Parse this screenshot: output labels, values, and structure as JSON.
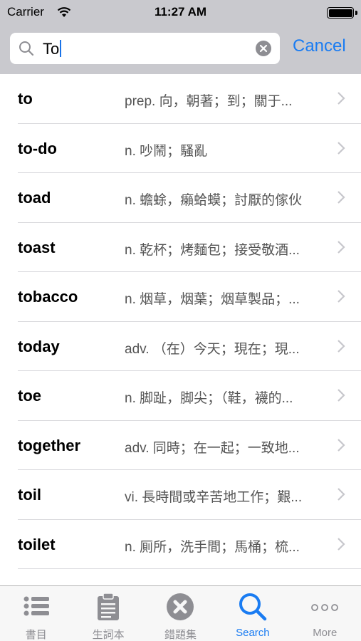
{
  "status_bar": {
    "carrier": "Carrier",
    "time": "11:27 AM"
  },
  "search": {
    "value": "To",
    "cancel_label": "Cancel"
  },
  "results": [
    {
      "word": "to",
      "definition": "prep. 向，朝著；到；關于..."
    },
    {
      "word": "to-do",
      "definition": "n. 吵鬧；騷亂"
    },
    {
      "word": "toad",
      "definition": "n. 蟾蜍，癩蛤蟆；討厭的傢伙"
    },
    {
      "word": "toast",
      "definition": "n. 乾杯；烤麵包；接受敬酒..."
    },
    {
      "word": "tobacco",
      "definition": "n. 烟草，烟葉；烟草製品；..."
    },
    {
      "word": "today",
      "definition": "adv. （在）今天；現在；現..."
    },
    {
      "word": "toe",
      "definition": "n. 脚趾，脚尖；（鞋，襪的..."
    },
    {
      "word": "together",
      "definition": "adv. 同時；在一起；一致地..."
    },
    {
      "word": "toil",
      "definition": "vi. 長時間或辛苦地工作；艱..."
    },
    {
      "word": "toilet",
      "definition": "n. 厠所，洗手間；馬桶；梳..."
    }
  ],
  "tabs": [
    {
      "label": "書目",
      "icon": "list-icon"
    },
    {
      "label": "生詞本",
      "icon": "clipboard-icon"
    },
    {
      "label": "錯題集",
      "icon": "x-circle-icon"
    },
    {
      "label": "Search",
      "icon": "search-icon"
    },
    {
      "label": "More",
      "icon": "more-icon"
    }
  ],
  "colors": {
    "accent": "#1a7cf2",
    "header_bg": "#c9c9ce",
    "inactive_tab": "#8e8e93"
  }
}
